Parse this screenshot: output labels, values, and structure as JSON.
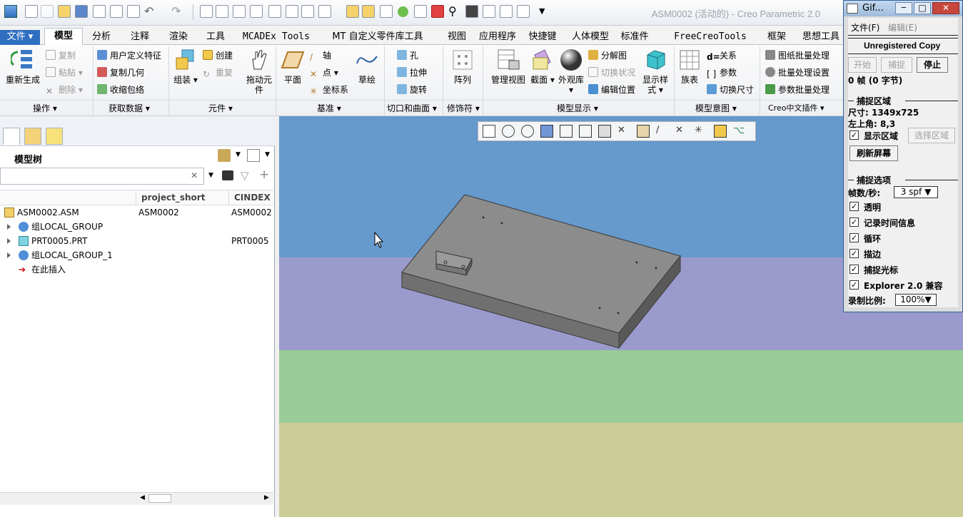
{
  "window": {
    "title": "ASM0002 (活动的) - Creo Parametric 2.0"
  },
  "tabs": [
    "文件",
    "模型",
    "分析",
    "注释",
    "渲染",
    "工具",
    "MCADEx Tools",
    "MT 自定义零件库工具",
    "视图",
    "应用程序",
    "快捷键",
    "人体模型",
    "标准件",
    "FreeCreoTools",
    "框架",
    "思想工具"
  ],
  "ribbon": {
    "regen": "重新生成",
    "copy": "复制",
    "paste": "粘贴",
    "delete": "删除",
    "udf": "用户定义特征",
    "copygeom": "复制几何",
    "shrinkwrap": "收缩包络",
    "assemble": "组装",
    "create": "创建",
    "repeat": "重复",
    "drag": "拖动元件",
    "plane": "平面",
    "axis": "轴",
    "point": "点",
    "csys": "坐标系",
    "sketch": "草绘",
    "hole": "孔",
    "extrude": "拉伸",
    "revolve": "旋转",
    "pattern": "阵列",
    "manageview": "管理视图",
    "section": "截面",
    "appearance": "外观库",
    "explode": "分解图",
    "togglestatus": "切换状况",
    "editpos": "编辑位置",
    "displaystyle": "显示样式",
    "family": "族表",
    "relations": "关系",
    "params": "参数",
    "switchdim": "切换尺寸",
    "batchdraw": "图纸批量处理",
    "batchset": "批量处理设置",
    "parambatch": "参数批量处理",
    "groups": [
      "操作",
      "获取数据",
      "元件",
      "基准",
      "切口和曲面",
      "修饰符",
      "模型显示",
      "模型意图",
      "Creo中文插件"
    ]
  },
  "model_tree": {
    "title": "模型树",
    "columns": [
      "project_short",
      "CINDEX"
    ],
    "rows": [
      {
        "name": "ASM0002.ASM",
        "c2": "ASM0002",
        "c3": "ASM0002"
      },
      {
        "name": "组LOCAL_GROUP",
        "c2": "",
        "c3": ""
      },
      {
        "name": "PRT0005.PRT",
        "c2": "",
        "c3": "PRT0005"
      },
      {
        "name": "组LOCAL_GROUP_1",
        "c2": "",
        "c3": ""
      },
      {
        "name": "在此插入",
        "c2": "",
        "c3": ""
      }
    ]
  },
  "gif": {
    "title": "Gif...",
    "menu_file": "文件(F)",
    "menu_edit": "编辑(E)",
    "banner": "Unregistered Copy",
    "start": "开始",
    "capture": "捕捉",
    "stop": "停止",
    "frames": "0 帧 (0 字节)",
    "area_title": "捕捉区域",
    "size": "尺寸: 1349x725",
    "topleft": "左上角: 8,3",
    "show_area": "显示区域",
    "select_area": "选择区域",
    "refresh": "刷新屏幕",
    "opts_title": "捕捉选项",
    "fps_label": "帧数/秒:",
    "fps_value": "3 spf",
    "opt_transparent": "透明",
    "opt_time": "记录时间信息",
    "opt_loop": "循环",
    "opt_edge": "描边",
    "opt_cursor": "捕捉光标",
    "opt_ie": "Explorer 2.0 兼容",
    "scale_label": "录制比例:",
    "scale_value": "100%"
  },
  "colors": {
    "accent": "#2f6fbf",
    "sky": "#6699cc",
    "band2": "#9a9acc",
    "band3": "#99cc99",
    "band4": "#cccc99",
    "part": "#8c8c8c"
  }
}
